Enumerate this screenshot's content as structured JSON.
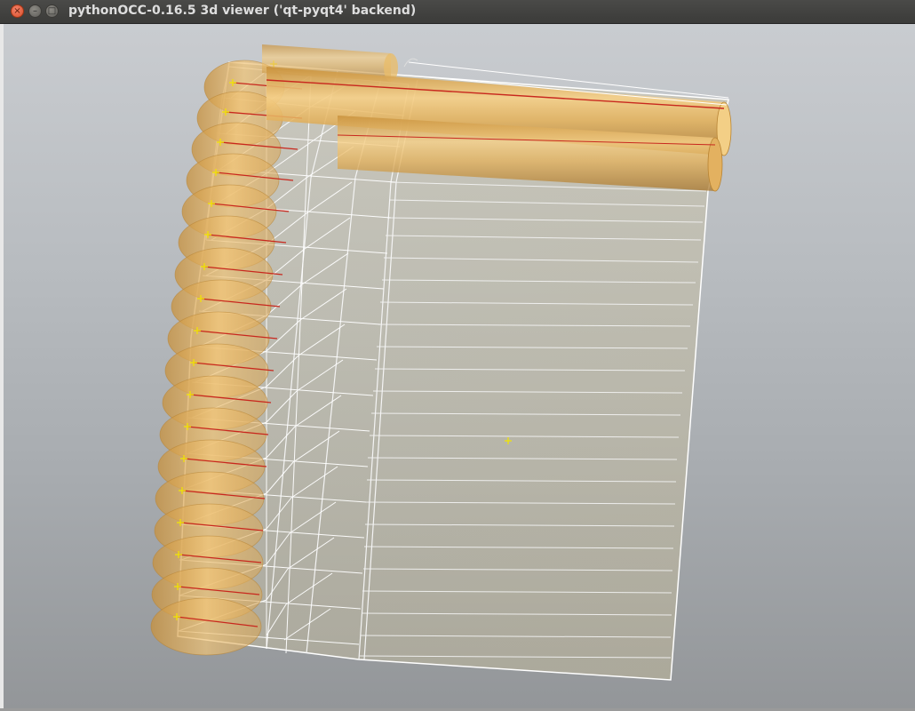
{
  "window": {
    "title": "pythonOCC-0.16.5 3d viewer ('qt-pyqt4' backend)",
    "buttons": {
      "close_glyph": "×",
      "minimize_glyph": "–",
      "maximize_glyph": "□"
    }
  },
  "viewport": {
    "background": "gradient grey",
    "model_color": "#e8b45a",
    "wireframe_color": "#ffffff",
    "axis_color": "#c8281e",
    "vertex_marker_color": "#f2e600"
  }
}
